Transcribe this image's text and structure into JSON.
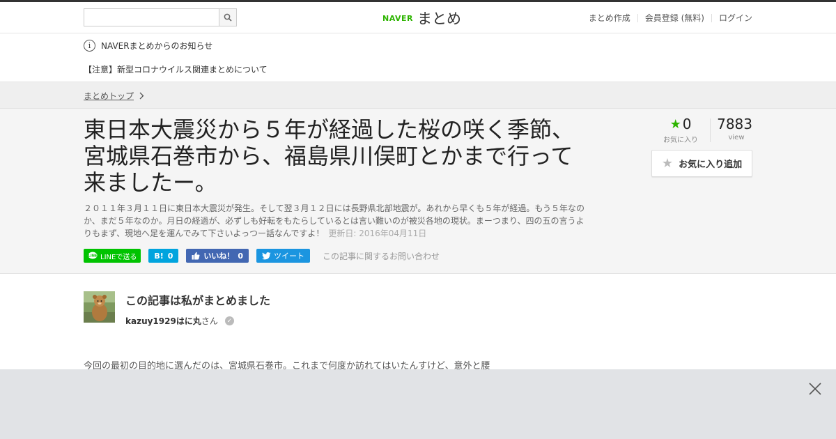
{
  "header": {
    "search_placeholder": "",
    "logo_brand": "NAVER",
    "logo_service": "まとめ",
    "links": [
      "まとめ作成",
      "会員登録 (無料)",
      "ログイン"
    ]
  },
  "notice": {
    "title": "NAVERまとめからのお知らせ",
    "item": "【注意】新型コロナウイルス関連まとめについて"
  },
  "breadcrumb": "まとめトップ",
  "article": {
    "title": "東日本大震災から５年が経過した桜の咲く季節、宮城県石巻市から、福島県川俣町とかまで行って来ましたー。",
    "description": "２０１１年３月１１日に東日本大震災が発生。そして翌３月１２日には長野県北部地震が。あれから早くも５年が経過。もう５年なのか、まだ５年なのか。月日の経過が、必ずしも好転をもたらしているとは言い難いのが被災各地の現状。まーつまり、四の五の言うよりもまず、現地へ足を運んでみて下さいよっつー話なんですよ！",
    "updated": "更新日: 2016年04月11日",
    "body_start": "今回の最初の目的地に選んだのは、宮城県石巻市。これまで何度か訪れてはいたんすけど、意外と腰"
  },
  "stats": {
    "favorites": "0",
    "favorites_label": "お気に入り",
    "views": "7883",
    "views_label": "view",
    "fav_button": "お気に入り追加"
  },
  "share": {
    "line": "LINEで送る",
    "hatena_icon": "B!",
    "hatena_count": "0",
    "fb": "いいね！",
    "fb_count": "0",
    "tweet": "ツイート",
    "inquiry": "この記事に関するお問い合わせ"
  },
  "author": {
    "heading": "この記事は私がまとめました",
    "name": "kazuy1929はに丸",
    "suffix": "さん"
  },
  "colors": {
    "naver_green": "#2db400",
    "line_green": "#00c300",
    "hatena_blue": "#00a4de",
    "facebook_blue": "#4267b2",
    "twitter_blue": "#1b95e0"
  }
}
